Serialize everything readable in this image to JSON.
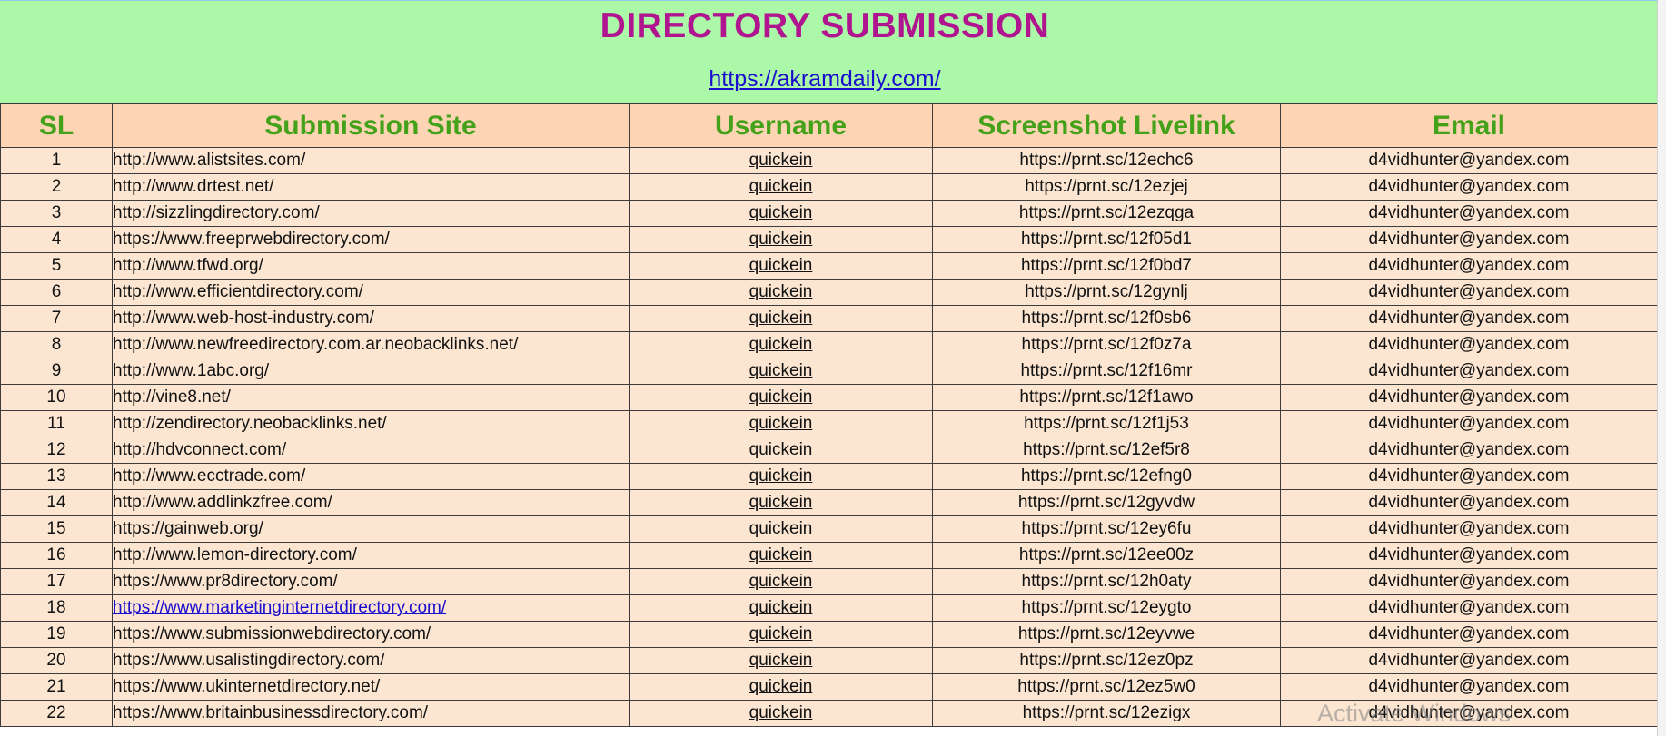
{
  "header": {
    "title": "DIRECTORY SUBMISSION",
    "link": "https://akramdaily.com/"
  },
  "table": {
    "columns": [
      "SL",
      "Submission Site",
      "Username",
      "Screenshot Livelink",
      "Email"
    ],
    "rows": [
      {
        "sl": "1",
        "site": "http://www.alistsites.com/",
        "username": "quickein",
        "shot": "https://prnt.sc/12echc6",
        "email": "d4vidhunter@yandex.com"
      },
      {
        "sl": "2",
        "site": "http://www.drtest.net/",
        "username": "quickein",
        "shot": "https://prnt.sc/12ezjej",
        "email": "d4vidhunter@yandex.com"
      },
      {
        "sl": "3",
        "site": "http://sizzlingdirectory.com/",
        "username": "quickein",
        "shot": "https://prnt.sc/12ezqga",
        "email": "d4vidhunter@yandex.com"
      },
      {
        "sl": "4",
        "site": "https://www.freeprwebdirectory.com/",
        "username": "quickein",
        "shot": "https://prnt.sc/12f05d1",
        "email": "d4vidhunter@yandex.com"
      },
      {
        "sl": "5",
        "site": "http://www.tfwd.org/",
        "username": "quickein",
        "shot": "https://prnt.sc/12f0bd7",
        "email": "d4vidhunter@yandex.com"
      },
      {
        "sl": "6",
        "site": "http://www.efficientdirectory.com/",
        "username": "quickein",
        "shot": "https://prnt.sc/12gynlj",
        "email": "d4vidhunter@yandex.com"
      },
      {
        "sl": "7",
        "site": "http://www.web-host-industry.com/",
        "username": "quickein",
        "shot": "https://prnt.sc/12f0sb6",
        "email": "d4vidhunter@yandex.com"
      },
      {
        "sl": "8",
        "site": "http://www.newfreedirectory.com.ar.neobacklinks.net/",
        "username": "quickein",
        "shot": "https://prnt.sc/12f0z7a",
        "email": "d4vidhunter@yandex.com"
      },
      {
        "sl": "9",
        "site": "http://www.1abc.org/",
        "username": "quickein",
        "shot": "https://prnt.sc/12f16mr",
        "email": "d4vidhunter@yandex.com"
      },
      {
        "sl": "10",
        "site": "http://vine8.net/",
        "username": "quickein",
        "shot": "https://prnt.sc/12f1awo",
        "email": "d4vidhunter@yandex.com"
      },
      {
        "sl": "11",
        "site": "http://zendirectory.neobacklinks.net/",
        "username": "quickein",
        "shot": "https://prnt.sc/12f1j53",
        "email": "d4vidhunter@yandex.com"
      },
      {
        "sl": "12",
        "site": "http://hdvconnect.com/",
        "username": "quickein",
        "shot": "https://prnt.sc/12ef5r8",
        "email": "d4vidhunter@yandex.com"
      },
      {
        "sl": "13",
        "site": "http://www.ecctrade.com/",
        "username": "quickein",
        "shot": "https://prnt.sc/12efng0",
        "email": "d4vidhunter@yandex.com"
      },
      {
        "sl": "14",
        "site": "http://www.addlinkzfree.com/",
        "username": "quickein",
        "shot": "https://prnt.sc/12gyvdw",
        "email": "d4vidhunter@yandex.com"
      },
      {
        "sl": "15",
        "site": "https://gainweb.org/",
        "username": "quickein",
        "shot": "https://prnt.sc/12ey6fu",
        "email": "d4vidhunter@yandex.com"
      },
      {
        "sl": "16",
        "site": "http://www.lemon-directory.com/",
        "username": "quickein",
        "shot": "https://prnt.sc/12ee00z",
        "email": "d4vidhunter@yandex.com"
      },
      {
        "sl": "17",
        "site": "https://www.pr8directory.com/",
        "username": "quickein",
        "shot": "https://prnt.sc/12h0aty",
        "email": "d4vidhunter@yandex.com"
      },
      {
        "sl": "18",
        "site": "https://www.marketinginternetdirectory.com/",
        "site_is_link": true,
        "username": "quickein",
        "shot": "https://prnt.sc/12eygto",
        "email": "d4vidhunter@yandex.com"
      },
      {
        "sl": "19",
        "site": "https://www.submissionwebdirectory.com/",
        "username": "quickein",
        "shot": "https://prnt.sc/12eyvwe",
        "email": "d4vidhunter@yandex.com"
      },
      {
        "sl": "20",
        "site": "https://www.usalistingdirectory.com/",
        "username": "quickein",
        "shot": "https://prnt.sc/12ez0pz",
        "email": "d4vidhunter@yandex.com"
      },
      {
        "sl": "21",
        "site": "https://www.ukinternetdirectory.net/",
        "username": "quickein",
        "shot": "https://prnt.sc/12ez5w0",
        "email": "d4vidhunter@yandex.com"
      },
      {
        "sl": "22",
        "site": "https://www.britainbusinessdirectory.com/",
        "username": "quickein",
        "shot": "https://prnt.sc/12ezigx",
        "email": "d4vidhunter@yandex.com"
      }
    ]
  },
  "watermark": "Activate Windows",
  "colors": {
    "title_band": "#aaf8a8",
    "title_text": "#b0158f",
    "header_fill": "#fdd5b4",
    "header_text": "#43a11a",
    "row_fill": "#fce6d2",
    "link": "#1a0dcd"
  }
}
